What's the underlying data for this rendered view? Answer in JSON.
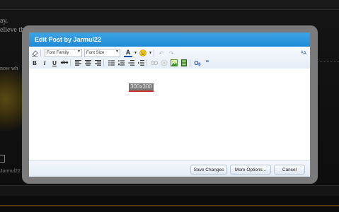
{
  "background": {
    "line1": "ay.",
    "line2": "elieve th",
    "line3": "now wh",
    "user_label": "Jarmul22"
  },
  "dialog": {
    "title": "Edit Post by Jarmul22",
    "toolbar": {
      "font_family": "Font Family",
      "font_size": "Font Size"
    },
    "editor_content": "300x300",
    "buttons": {
      "save": "Save Changes",
      "more": "More Options...",
      "cancel": "Cancel"
    }
  },
  "colors": {
    "title_bar": "#1e8ad6",
    "frame": "#7a7a7a"
  }
}
